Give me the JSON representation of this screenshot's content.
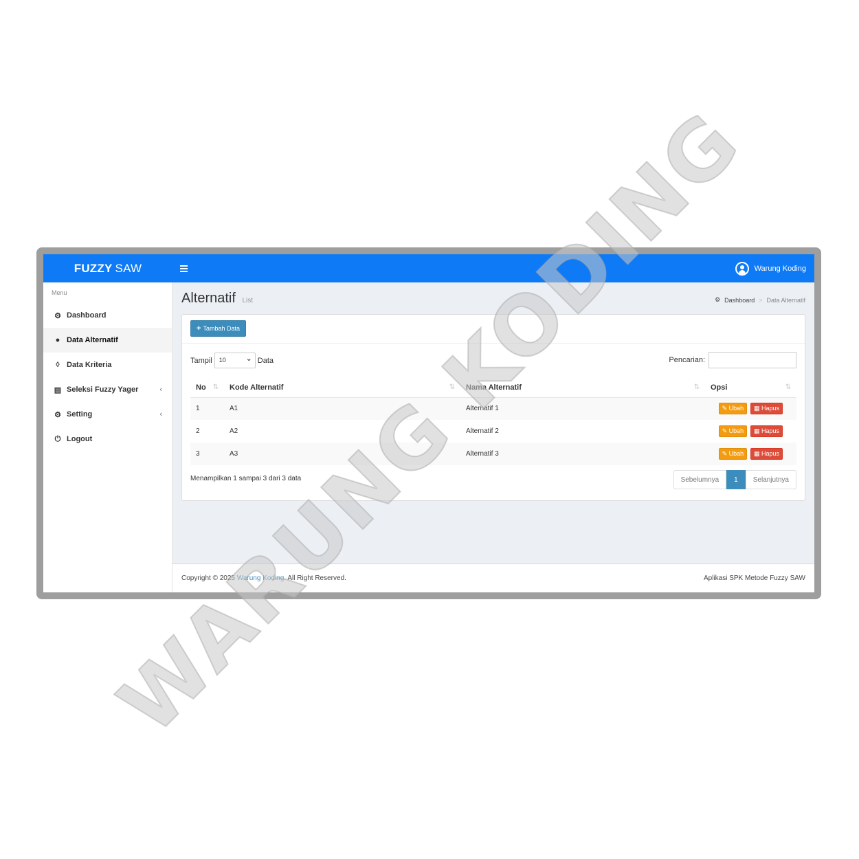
{
  "app": {
    "logo_bold": "FUZZY",
    "logo_rest": "SAW",
    "user_name": "Warung Koding"
  },
  "sidebar": {
    "header": "Menu",
    "items": [
      {
        "label": "Dashboard",
        "icon": "dashboard-icon"
      },
      {
        "label": "Data Alternatif",
        "icon": "users-icon",
        "active": true
      },
      {
        "label": "Data Kriteria",
        "icon": "cubes-icon"
      },
      {
        "label": "Seleksi Fuzzy Yager",
        "icon": "bar-chart-icon",
        "has_submenu": true
      },
      {
        "label": "Setting",
        "icon": "gear-icon",
        "has_submenu": true
      },
      {
        "label": "Logout",
        "icon": "power-icon"
      }
    ]
  },
  "page": {
    "title": "Alternatif",
    "subtitle": "List"
  },
  "breadcrumb": {
    "home": "Dashboard",
    "current": "Data Alternatif"
  },
  "box": {
    "add_button": "Tambah Data"
  },
  "table_controls": {
    "show_label": "Tampil",
    "page_size": "10",
    "data_label": "Data",
    "search_label": "Pencarian:"
  },
  "table": {
    "headers": [
      "No",
      "Kode Alternatif",
      "Nama Alternatif",
      "Opsi"
    ],
    "rows": [
      {
        "no": "1",
        "kode": "A1",
        "nama": "Alternatif 1"
      },
      {
        "no": "2",
        "kode": "A2",
        "nama": "Alternatif 2"
      },
      {
        "no": "3",
        "kode": "A3",
        "nama": "Alternatif 3"
      }
    ],
    "edit_label": "Ubah",
    "delete_label": "Hapus"
  },
  "pagination": {
    "info": "Menampilkan 1 sampai 3 dari 3 data",
    "prev": "Sebelumnya",
    "current": "1",
    "next": "Selanjutnya"
  },
  "footer": {
    "copyright_prefix": "Copyright © 2025",
    "copyright_link": "Warung Koding",
    "copyright_suffix": ". All Right Reserved.",
    "right": "Aplikasi SPK Metode Fuzzy SAW"
  },
  "watermark": "WARUNG KODING",
  "colors": {
    "header": "#0f7af5",
    "primary": "#3c8dbc",
    "warning": "#f39c12",
    "danger": "#dd4b39"
  }
}
